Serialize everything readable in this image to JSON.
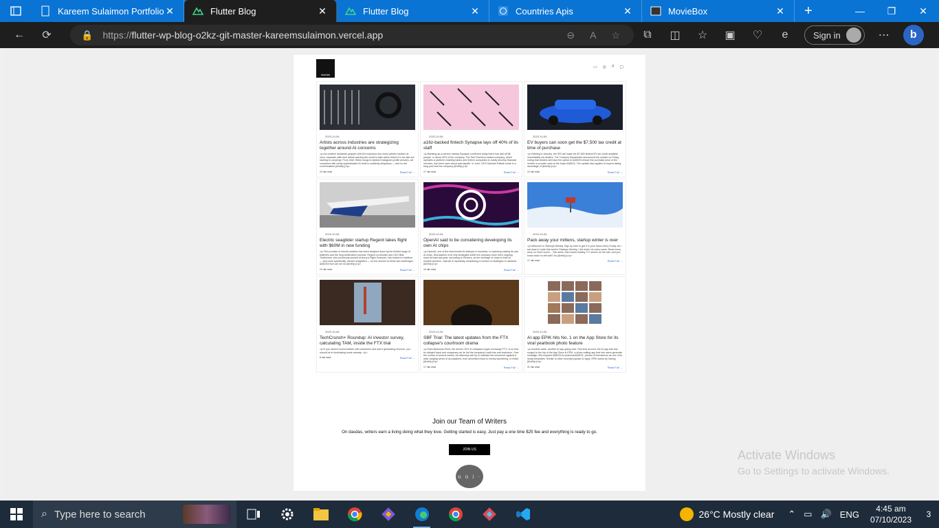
{
  "browser": {
    "tabs": [
      {
        "title": "Kareem Sulaimon Portfolio W",
        "icon": "document-icon",
        "active": false
      },
      {
        "title": "Flutter Blog",
        "icon": "nuxt-icon",
        "active": true
      },
      {
        "title": "Flutter Blog",
        "icon": "nuxt-icon",
        "active": false
      },
      {
        "title": "Countries Apis",
        "icon": "globe-icon",
        "active": false
      },
      {
        "title": "MovieBox",
        "icon": "movie-icon",
        "active": false
      }
    ],
    "new_tab": "+",
    "url_prefix": "https://",
    "url_host": "flutter-wp-blog-o2kz-git-master-kareemsulaimon.vercel.app",
    "signin_label": "Sign in",
    "bing_label": "b"
  },
  "site": {
    "logo_text": "dasdas",
    "posts": [
      {
        "date": "2023-10-06",
        "title": "Artists across industries are strategizing together around AI concerns",
        "excerpt": "<p>As creative industries grapple with AI's explosion into every artistic medium at once, separate calls from artists warning the world to take action before it's too late are starting to converge. From Uber Strike songs to stylized Instagram profile pictures, art compared with newly sophisticated AI tools is suddenly ubiquitous — and so are conversations [&hellip;]</p>",
        "read": "10 min read",
        "more": "Read Full",
        "img": "img-mixer"
      },
      {
        "date": "2023-10-06",
        "title": "a16z-backed fintech Synapse lays off 40% of its staff",
        "excerpt": "<p>Banking-as-a-service startup Synapse confirmed today that it has laid off 88 people, or about 40% of the company. The San Francisco-based company, which operates a platform enabling banks and fintech companies to easily develop financial services, has been open about past layoffs. In June, CEO Sankaet Pathak wrote in a blog post that the company [&hellip;]</p>",
        "read": "17 min read",
        "more": "Read Full",
        "img": "img-scissors"
      },
      {
        "date": "2023-10-06",
        "title": "EV buyers can soon get the $7,500 tax credit at time of purchase",
        "excerpt": "<p>Starting in January, the IRS will make the $7,500 federal EV tax credit available immediately via dealers. The Treasury Department announced the update on Friday, noting that dealers will have the option to &#8220;reduce the purchase price of the vehicle or provide cash to the buyer.&#8221; The update also applies to buyers taking advantage of [&hellip;]</p>",
        "read": "12 min read",
        "more": "Read Full",
        "img": "img-car"
      },
      {
        "date": "2023-10-06",
        "title": "Electric seaglider startup Regent takes flight with $60M in new funding",
        "excerpt": "<p>The promise of electric aviation has been weighed down by the limited range of batteries and the long certification process. Regent co-founder and CEO Billy Thalheimer, who previously worked at Aurora Flight Sciences, has looked to maritime — and more specifically, electric seagliders — for the answer to these two challenges. &#8220;How can we do [&hellip;]</p>",
        "read": "13 min read",
        "more": "Read Full",
        "img": "img-seaglider"
      },
      {
        "date": "2023-10-06",
        "title": "OpenAI said to be considering developing its own AI chips",
        "excerpt": "<p>OpenAI, one of the best-funded AI startups in business, is exploring making its own AI chips. Discussions of AI chip strategies within the company have been ongoing since at least last year, according to Reuters, as the shortage of chips to train AI models worsens. OpenAI is reportedly considering a number of strategies to advance [&hellip;]</p>",
        "read": "10 min read",
        "more": "Read Full",
        "img": "img-openai"
      },
      {
        "date": "2023-10-06",
        "title": "Pack away your mittens, startup winter is over",
        "excerpt": "<p>Welcome to Startups Weekly. Sign up here to get it in your inbox every Friday. As I sat down to write this week's Startups Weekly, I did what I do every week: Read every story on TechCrunch… this week, that meant reading 717 stories on the site, and you know what I'm left with? An [&hellip;]</p>",
        "read": "17 min read",
        "more": "Read Full",
        "img": "img-snow"
      },
      {
        "date": "2023-10-06",
        "title": "TechCrunch+ Roundup: AI investor survey, calculating TAM, inside the FTX trial",
        "excerpt": "<p>If you haven't found traction with customers and aren't generating revenue, you should be in fundraising mode already. </p>",
        "read": "8 min read",
        "more": "Read Full",
        "img": "img-bridge"
      },
      {
        "date": "2023-10-06",
        "title": "SBF Trial: The latest updates from the FTX collapse's courtroom drama",
        "excerpt": "<p>Sam Bankman-Fried, the former CEO of collapsed crypto exchange FTX, is on trial for alleged fraud and conspiracy as he led the company's swift rise and implosion. Over the course of several weeks, his attorneys will try to maintain his innocence against a wide-ranging series of accusations, from securities fraud to money laundering, to which [&hellip;]</p>",
        "read": "17 min read",
        "more": "Read Full",
        "img": "img-hair"
      },
      {
        "date": "2023-10-06",
        "title": "AI app EPIK hits No. 1 on the App Store for its viral yearbook photo feature",
        "excerpt": "<p>Another week, another AI app going viral. This time around, the AI app that has surged to the top of the App Store is EPIK, a photo-editing app that lets users generate nostalgic, 90s-inspired &#8220;AI yearbook&#8221; photos of themselves as one of its newly templates. Similar to other recently popular AI apps, EPIK works by having [&hellip;]</p>",
        "read": "21 min read",
        "more": "Read Full",
        "img": "img-yearbook"
      }
    ],
    "cta_title": "Join our Team of Writers",
    "cta_text": "On dasdas, writers earn a living doing what they love. Getting started is easy. Just pay a one time $25 fee and everything is ready to go.",
    "cta_button": "JOIN US",
    "fab_label": "o o i ·"
  },
  "watermark": {
    "line1": "Activate Windows",
    "line2": "Go to Settings to activate Windows."
  },
  "taskbar": {
    "search_placeholder": "Type here to search",
    "weather": "26°C  Mostly clear",
    "lang": "ENG",
    "time": "4:45 am",
    "date": "07/10/2023",
    "notif_count": "3"
  }
}
